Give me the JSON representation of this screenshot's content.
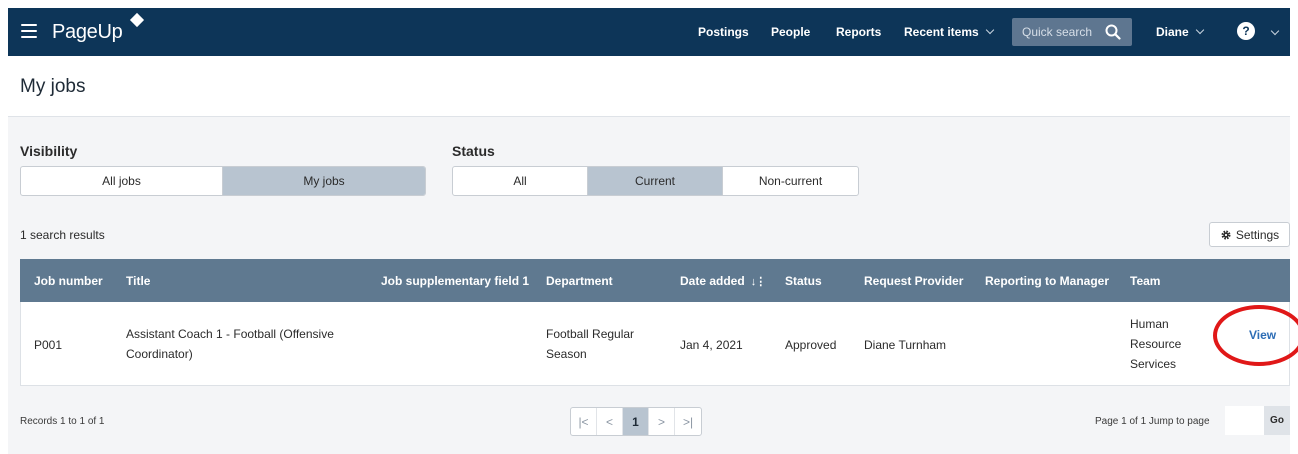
{
  "header": {
    "logo": "PageUp",
    "nav": [
      "Postings",
      "People",
      "Reports",
      "Recent items"
    ],
    "quick_search_placeholder": "Quick search",
    "user": "Diane"
  },
  "page_title": "My jobs",
  "filters": {
    "visibility_label": "Visibility",
    "visibility_options": [
      "All jobs",
      "My jobs"
    ],
    "visibility_selected": "My jobs",
    "status_label": "Status",
    "status_options": [
      "All",
      "Current",
      "Non-current"
    ],
    "status_selected": "Current"
  },
  "results_count": "1 search results",
  "settings_label": "Settings",
  "table": {
    "columns": [
      "Job number",
      "Title",
      "Job supplementary field 1",
      "Department",
      "Date added",
      "Status",
      "Request Provider",
      "Reporting to Manager",
      "Team"
    ],
    "rows": [
      {
        "job_number": "P001",
        "title_line1": "Assistant Coach 1 - Football (Offensive",
        "title_line2": "Coordinator)",
        "supplementary": "",
        "dept_line1": "Football Regular",
        "dept_line2": "Season",
        "date_added": "Jan 4, 2021",
        "status": "Approved",
        "request_provider": "Diane Turnham",
        "reporting_manager": "",
        "team_line1": "Human",
        "team_line2": "Resource",
        "team_line3": "Services",
        "action": "View"
      }
    ]
  },
  "footer": {
    "records": "Records 1 to 1 of 1",
    "current_page": "1",
    "page_info": "Page 1 of 1  Jump to page",
    "go_label": "Go"
  },
  "colors": {
    "topbar": "#0d3558",
    "table_header": "#5f7990",
    "active_segment": "#b8c4d0",
    "link": "#2d6db5",
    "highlight": "#e01818"
  }
}
